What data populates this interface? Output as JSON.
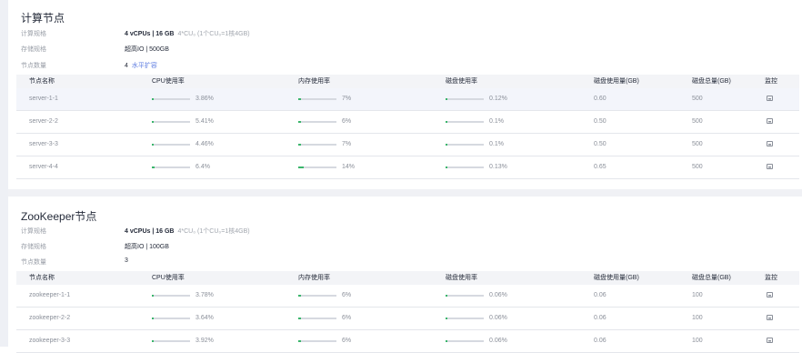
{
  "compute": {
    "title": "计算节点",
    "specs_label": "计算规格",
    "specs_value": "4 vCPUs | 16 GB",
    "specs_hint": "4*CU₀ (1个CU₀=1核4GB)",
    "storage_label": "存储规格",
    "storage_value": "超高IO | 500GB",
    "count_label": "节点数量",
    "count_value": "4",
    "scale_link": "水平扩容",
    "columns": [
      "节点名称",
      "CPU使用率",
      "内存使用率",
      "磁盘使用率",
      "磁盘使用量(GB)",
      "磁盘总量(GB)",
      "监控"
    ],
    "rows": [
      {
        "name": "server-1-1",
        "cpu": "3.86%",
        "cpu_v": 3.86,
        "mem": "7%",
        "mem_v": 7,
        "disk": "0.12%",
        "disk_v": 0.12,
        "used": "0.60",
        "total": "500"
      },
      {
        "name": "server-2-2",
        "cpu": "5.41%",
        "cpu_v": 5.41,
        "mem": "6%",
        "mem_v": 6,
        "disk": "0.1%",
        "disk_v": 0.1,
        "used": "0.50",
        "total": "500"
      },
      {
        "name": "server-3-3",
        "cpu": "4.46%",
        "cpu_v": 4.46,
        "mem": "7%",
        "mem_v": 7,
        "disk": "0.1%",
        "disk_v": 0.1,
        "used": "0.50",
        "total": "500"
      },
      {
        "name": "server-4-4",
        "cpu": "6.4%",
        "cpu_v": 6.4,
        "mem": "14%",
        "mem_v": 14,
        "disk": "0.13%",
        "disk_v": 0.13,
        "used": "0.65",
        "total": "500"
      }
    ]
  },
  "zookeeper": {
    "title": "ZooKeeper节点",
    "specs_label": "计算规格",
    "specs_value": "4 vCPUs | 16 GB",
    "specs_hint": "4*CU₀ (1个CU₀=1核4GB)",
    "storage_label": "存储规格",
    "storage_value": "超高IO | 100GB",
    "count_label": "节点数量",
    "count_value": "3",
    "columns": [
      "节点名称",
      "CPU使用率",
      "内存使用率",
      "磁盘使用率",
      "磁盘使用量(GB)",
      "磁盘总量(GB)",
      "监控"
    ],
    "rows": [
      {
        "name": "zookeeper-1-1",
        "cpu": "3.78%",
        "cpu_v": 3.78,
        "mem": "6%",
        "mem_v": 6,
        "disk": "0.06%",
        "disk_v": 0.06,
        "used": "0.06",
        "total": "100"
      },
      {
        "name": "zookeeper-2-2",
        "cpu": "3.64%",
        "cpu_v": 3.64,
        "mem": "6%",
        "mem_v": 6,
        "disk": "0.06%",
        "disk_v": 0.06,
        "used": "0.06",
        "total": "100"
      },
      {
        "name": "zookeeper-3-3",
        "cpu": "3.92%",
        "cpu_v": 3.92,
        "mem": "6%",
        "mem_v": 6,
        "disk": "0.06%",
        "disk_v": 0.06,
        "used": "0.06",
        "total": "100"
      }
    ]
  },
  "colors": {
    "accent": "#5e7ce0",
    "bar_fill": "#3ab56b",
    "bar_track": "#d6d9e0"
  },
  "icons": {
    "monitor": "monitor-icon"
  }
}
